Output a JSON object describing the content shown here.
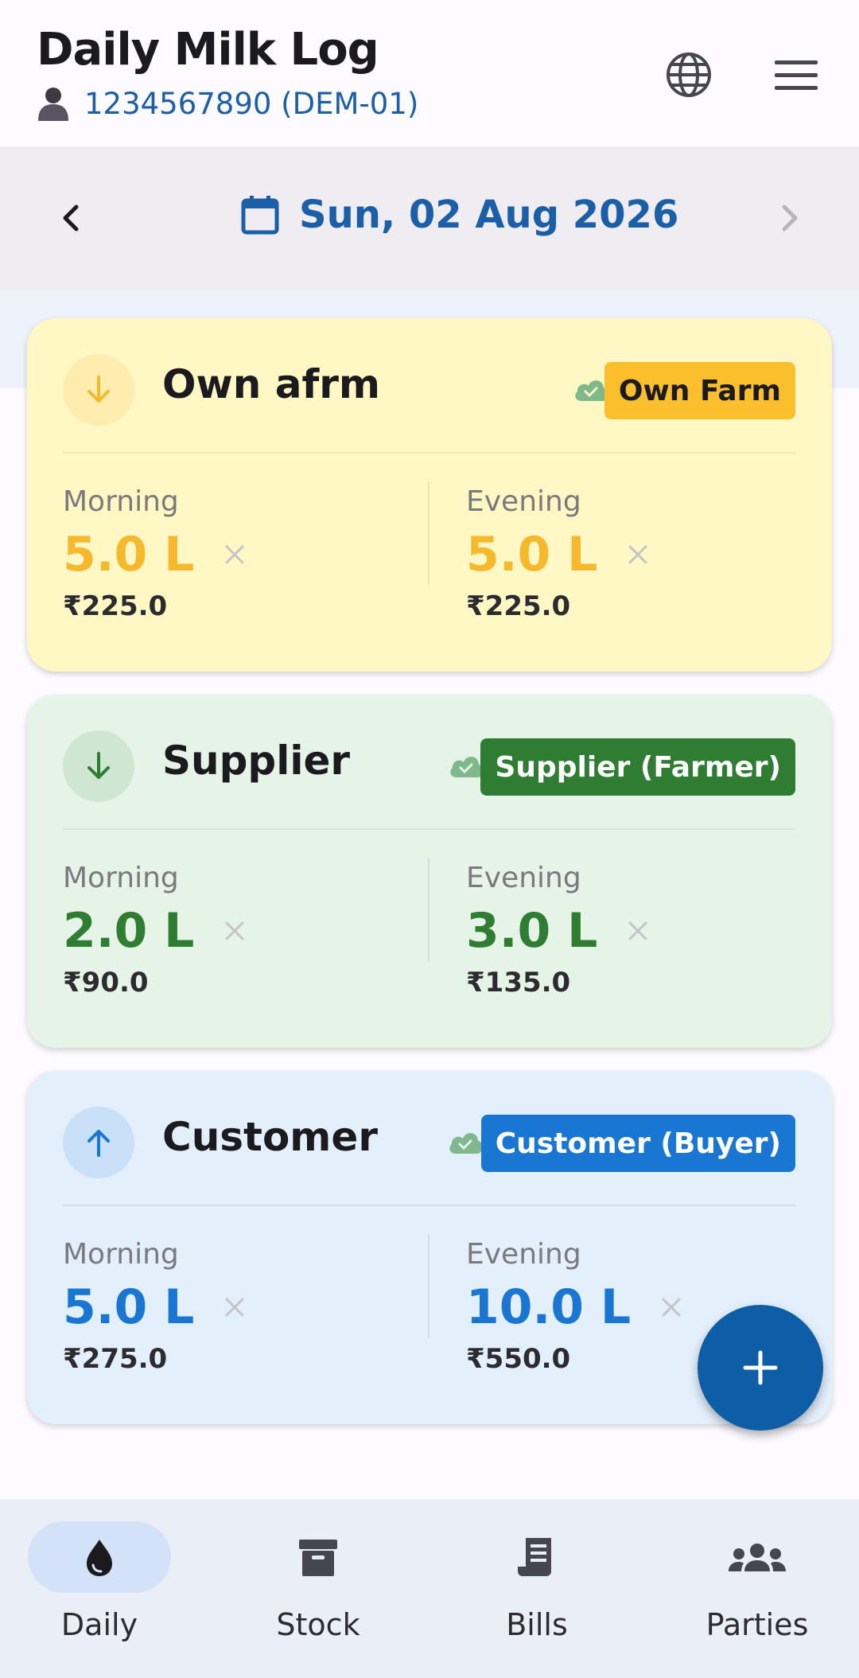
{
  "header": {
    "title": "Daily Milk Log",
    "user_id": "1234567890 (DEM-01)"
  },
  "date_bar": {
    "date": "Sun, 02 Aug 2026"
  },
  "cards": [
    {
      "name": "Own afrm",
      "badge": "Own Farm",
      "direction": "incoming",
      "synced": true,
      "morning_label": "Morning",
      "morning_qty": "5.0 L",
      "morning_amount": "₹225.0",
      "evening_label": "Evening",
      "evening_qty": "5.0 L",
      "evening_amount": "₹225.0",
      "accent": "#f6b82c"
    },
    {
      "name": "Supplier",
      "badge": "Supplier (Farmer)",
      "direction": "incoming",
      "synced": true,
      "morning_label": "Morning",
      "morning_qty": "2.0 L",
      "morning_amount": "₹90.0",
      "evening_label": "Evening",
      "evening_qty": "3.0 L",
      "evening_amount": "₹135.0",
      "accent": "#2e7d32"
    },
    {
      "name": "Customer",
      "badge": "Customer (Buyer)",
      "direction": "outgoing",
      "synced": true,
      "morning_label": "Morning",
      "morning_qty": "5.0 L",
      "morning_amount": "₹275.0",
      "evening_label": "Evening",
      "evening_qty": "10.0 L",
      "evening_amount": "₹550.0",
      "accent": "#1976d2"
    }
  ],
  "bottom_nav": {
    "items": [
      {
        "label": "Daily",
        "icon": "droplet-icon",
        "active": true
      },
      {
        "label": "Stock",
        "icon": "archive-box-icon",
        "active": false
      },
      {
        "label": "Bills",
        "icon": "receipt-icon",
        "active": false
      },
      {
        "label": "Parties",
        "icon": "people-group-icon",
        "active": false
      }
    ]
  },
  "colors": {
    "primary": "#1a5fa8",
    "fab": "#0d5ea6",
    "own_farm_badge": "#fbbf2d",
    "supplier_badge": "#2e7d32",
    "customer_badge": "#1976d2",
    "synced_cloud": "#7fb88a"
  }
}
